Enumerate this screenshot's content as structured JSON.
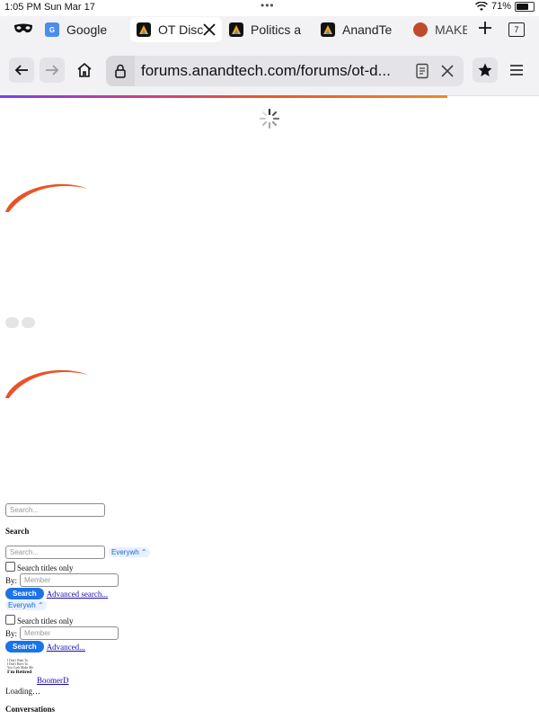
{
  "status_bar": {
    "time": "1:05 PM",
    "date": "Sun Mar 17",
    "battery": "71%",
    "battery_level": 0.71
  },
  "tabs": [
    {
      "label": "Google",
      "favicon": "google-news-icon"
    },
    {
      "label": "OT Disc",
      "favicon": "anandtech-icon",
      "active": true
    },
    {
      "label": "Politics a",
      "favicon": "anandtech-icon"
    },
    {
      "label": "AnandTe",
      "favicon": "anandtech-icon"
    },
    {
      "label": "MAKE A",
      "favicon": "make-icon"
    }
  ],
  "tab_count": "7",
  "url": "forums.anandtech.com/forums/ot-d...",
  "content": {
    "search_placeholder_top": "Search...",
    "search_heading": "Search",
    "search_placeholder": "Search...",
    "scope_select": "Everywh",
    "titles_only": "Search titles only",
    "by_label": "By:",
    "member_placeholder": "Member",
    "search_button": "Search",
    "advanced_search": "Advanced search...",
    "scope_select_2": "Everywh",
    "titles_only_2": "Search titles only",
    "by_label_2": "By:",
    "member_placeholder_2": "Member",
    "search_button_2": "Search",
    "advanced_2": "Advanced...",
    "avatar_lines": [
      "I Don't Want To.",
      "I Don't Have To.",
      "You Can't Make Me.",
      "I'm Retired"
    ],
    "username": "BoomerD",
    "loading": "Loading…",
    "conversations": "Conversations"
  },
  "colors": {
    "accent_swoosh": "#e8542a",
    "button_blue": "#1a73e8",
    "link": "#1a0dab"
  }
}
